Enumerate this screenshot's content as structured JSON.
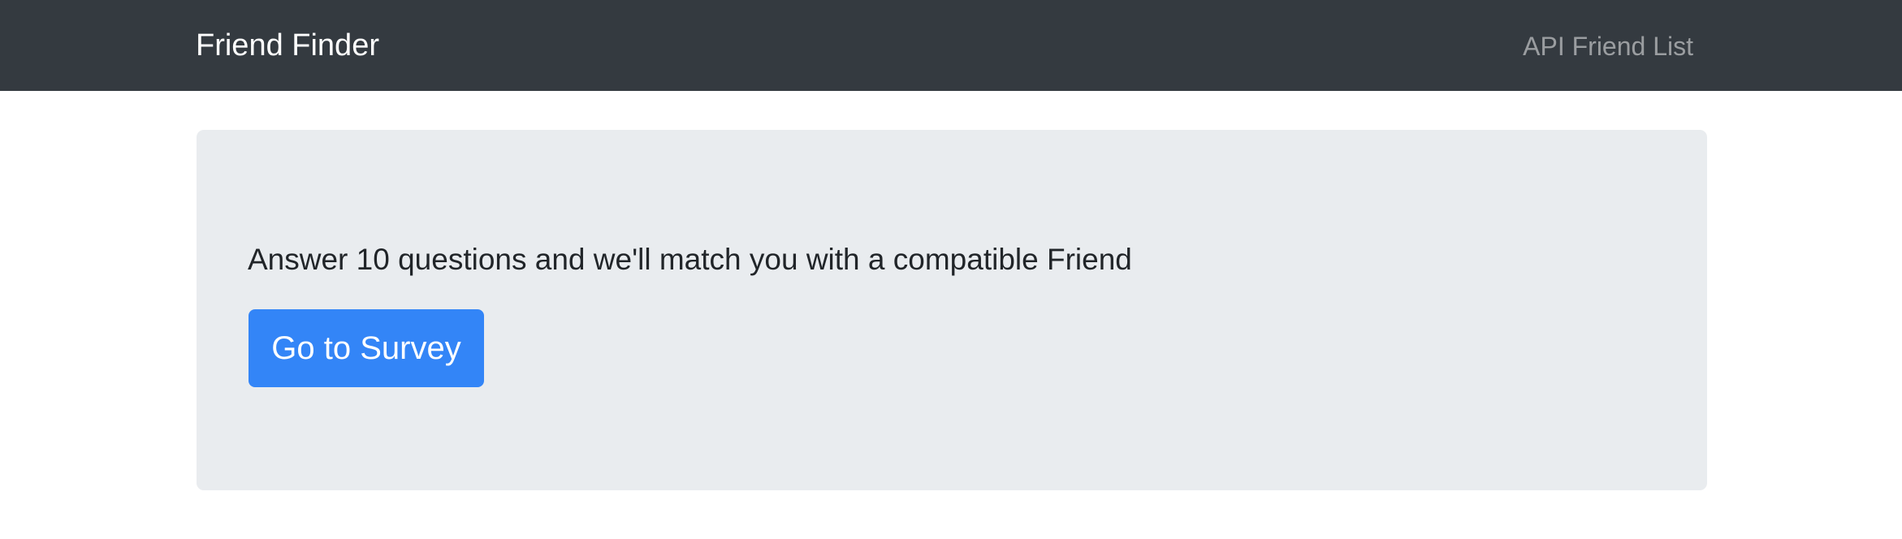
{
  "navbar": {
    "brand": "Friend Finder",
    "link": "API Friend List",
    "background_color": "#343a40"
  },
  "jumbotron": {
    "lead_text": "Answer 10 questions and we'll match you with a compatible Friend",
    "button_label": "Go to Survey",
    "background_color": "#e9ecef",
    "button_color": "#3385f7"
  }
}
